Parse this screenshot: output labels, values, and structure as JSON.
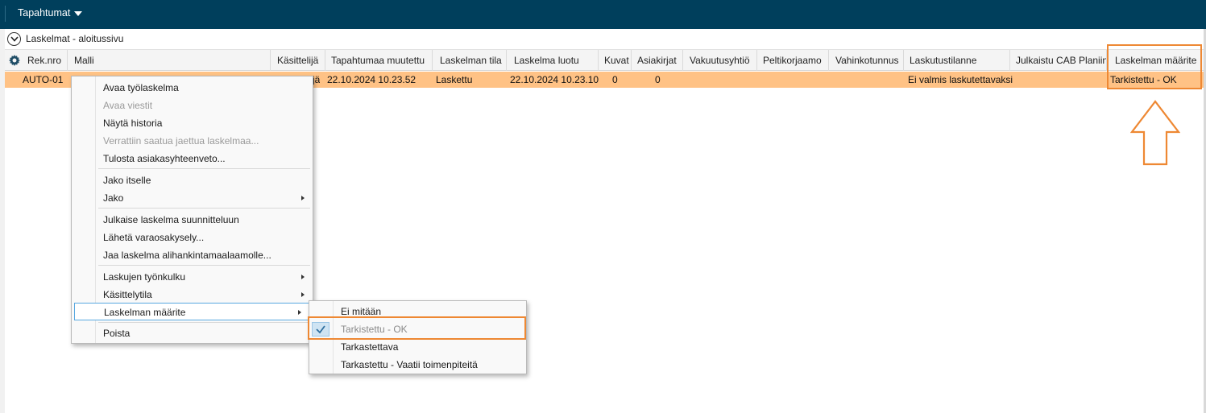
{
  "topbar": {
    "menu_label": "Tapahtumat"
  },
  "breadcrumb": {
    "label": "Laskelmat - aloitussivu"
  },
  "columns": [
    "Rek.nro",
    "Malli",
    "Käsittelijä",
    "Tapahtumaa muutettu",
    "Laskelman tila",
    "Laskelma luotu",
    "Kuvat",
    "Asiakirjat",
    "Vakuutusyhtiö",
    "Peltikorjaamo",
    "Vahinkotunnus",
    "Laskutustilanne",
    "Julkaistu CAB Planiin",
    "Laskelman määrite"
  ],
  "row": {
    "rek_nro": "AUTO-01",
    "kasittelija_visible": "jä",
    "tapahtumaa_muutettu": "22.10.2024 10.23.52",
    "laskelman_tila": "Laskettu",
    "laskelma_luotu": "22.10.2024 10.23.10",
    "kuvat": "0",
    "asiakirjat": "0",
    "laskutustilanne": "Ei valmis laskutettavaksi",
    "laskelman_maarite": "Tarkistettu - OK"
  },
  "context_menu": [
    {
      "label": "Avaa työlaskelma"
    },
    {
      "label": "Avaa viestit"
    },
    {
      "label": "Näytä historia"
    },
    {
      "label": "Verrattiin saatua jaettua laskelmaa..."
    },
    {
      "label": "Tulosta asiakasyhteenveto..."
    },
    {
      "label": "Jako itselle"
    },
    {
      "label": "Jako"
    },
    {
      "label": "Julkaise laskelma suunnitteluun"
    },
    {
      "label": "Lähetä varaosakysely..."
    },
    {
      "label": "Jaa laskelma alihankintamaalaamolle..."
    },
    {
      "label": "Laskujen työnkulku"
    },
    {
      "label": "Käsittelytila"
    },
    {
      "label": "Laskelman määrite"
    },
    {
      "label": "Poista"
    }
  ],
  "submenu": [
    {
      "label": "Ei mitään"
    },
    {
      "label": "Tarkistettu - OK"
    },
    {
      "label": "Tarkastettava"
    },
    {
      "label": "Tarkastettu - Vaatii toimenpiteitä"
    }
  ],
  "colors": {
    "topbar": "#003f5c",
    "row_highlight": "#ffc285",
    "callout": "#ee8833",
    "menu_hover_border": "#58a8e0"
  }
}
